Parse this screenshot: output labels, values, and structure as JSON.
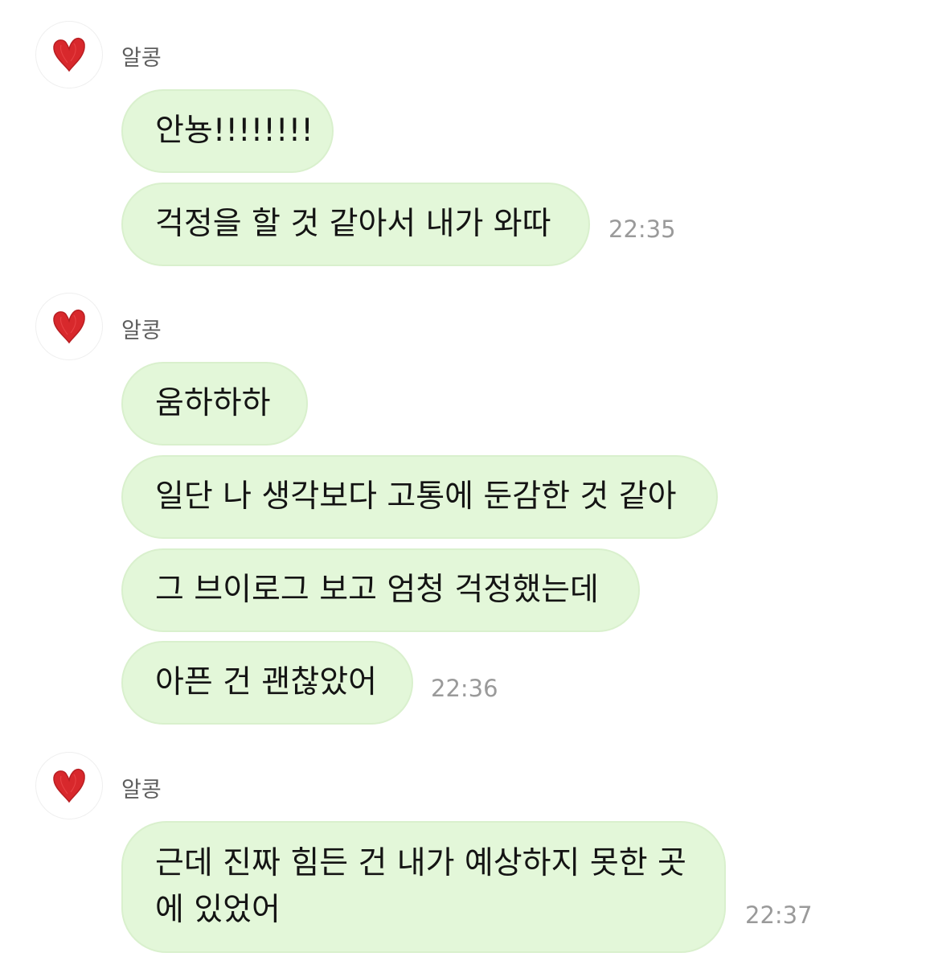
{
  "chat": {
    "groups": [
      {
        "sender": "알콩",
        "avatar_icon": "red-heart-icon",
        "messages": [
          "안뇽!!!!!!!!",
          "걱정을 할 것 같아서 내가 와따"
        ],
        "time": "22:35"
      },
      {
        "sender": "알콩",
        "avatar_icon": "red-heart-icon",
        "messages": [
          "움하하하",
          "일단 나 생각보다 고통에 둔감한 것 같아",
          "그 브이로그 보고 엄청 걱정했는데",
          "아픈 건 괜찮았어"
        ],
        "time": "22:36"
      },
      {
        "sender": "알콩",
        "avatar_icon": "red-heart-icon",
        "messages": [
          "근데 진짜 힘든 건 내가 예상하지 못한 곳\n에 있었어"
        ],
        "time": "22:37"
      }
    ]
  },
  "colors": {
    "bubble": "#e3f7d9",
    "bubble_border": "#d9f0cd",
    "heart": "#d8282c",
    "time": "#9a9a9a",
    "sender": "#5e5e5e"
  }
}
